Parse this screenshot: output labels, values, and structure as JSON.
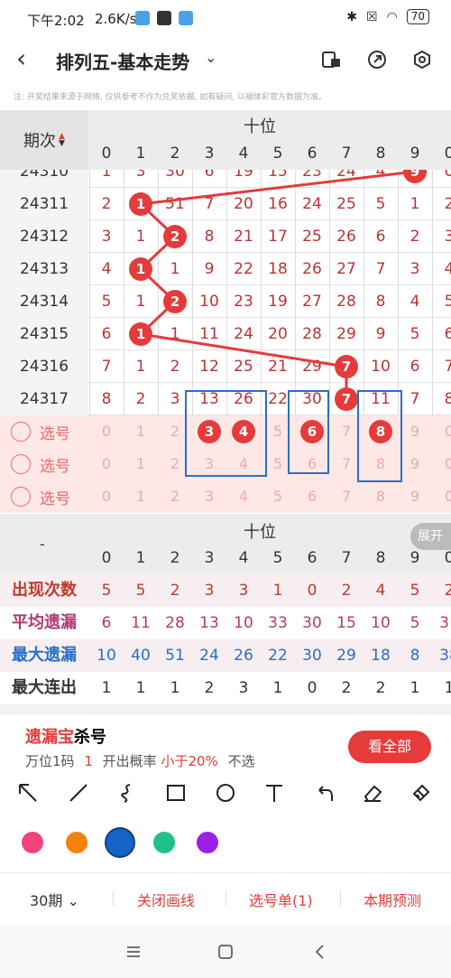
{
  "status": {
    "time": "下午2:02",
    "speed": "2.6K/s",
    "battery": "70"
  },
  "appbar": {
    "title": "排列五-基本走势"
  },
  "notice": "注: 开奖结果来源于网络, 仅供参考不作为兑奖依据, 如有疑问, 以福体彩官方数据为准。",
  "grid": {
    "period_header": "期次",
    "position_label": "十位",
    "columns": [
      "0",
      "1",
      "2",
      "3",
      "4",
      "5",
      "6",
      "7",
      "8",
      "9",
      "0"
    ],
    "rows": [
      {
        "period": "24310",
        "values": [
          "1",
          "3",
          "30",
          "6",
          "19",
          "15",
          "23",
          "24",
          "4",
          "9",
          "0"
        ],
        "hit": 9
      },
      {
        "period": "24311",
        "values": [
          "2",
          "1",
          "51",
          "7",
          "20",
          "16",
          "24",
          "25",
          "5",
          "1",
          "2"
        ],
        "hit": 1
      },
      {
        "period": "24312",
        "values": [
          "3",
          "1",
          "2",
          "8",
          "21",
          "17",
          "25",
          "26",
          "6",
          "2",
          "3"
        ],
        "hit": 2
      },
      {
        "period": "24313",
        "values": [
          "4",
          "1",
          "1",
          "9",
          "22",
          "18",
          "26",
          "27",
          "7",
          "3",
          "4"
        ],
        "hit": 1
      },
      {
        "period": "24314",
        "values": [
          "5",
          "1",
          "2",
          "10",
          "23",
          "19",
          "27",
          "28",
          "8",
          "4",
          "5"
        ],
        "hit": 2
      },
      {
        "period": "24315",
        "values": [
          "6",
          "1",
          "1",
          "11",
          "24",
          "20",
          "28",
          "29",
          "9",
          "5",
          "6"
        ],
        "hit": 1
      },
      {
        "period": "24316",
        "values": [
          "7",
          "1",
          "2",
          "12",
          "25",
          "21",
          "29",
          "7",
          "10",
          "6",
          "7"
        ],
        "hit": 7
      },
      {
        "period": "24317",
        "values": [
          "8",
          "2",
          "3",
          "13",
          "26",
          "22",
          "30",
          "7",
          "11",
          "7",
          "8"
        ],
        "hit": 7
      }
    ],
    "select_label": "选号",
    "select_rows": [
      {
        "nums": [
          "0",
          "1",
          "2",
          "3",
          "4",
          "5",
          "6",
          "7",
          "8",
          "9",
          "0"
        ],
        "balls": [
          3,
          4,
          6,
          8
        ]
      },
      {
        "nums": [
          "0",
          "1",
          "2",
          "3",
          "4",
          "5",
          "6",
          "7",
          "8",
          "9",
          "0"
        ],
        "balls": []
      },
      {
        "nums": [
          "0",
          "1",
          "2",
          "3",
          "4",
          "5",
          "6",
          "7",
          "8",
          "9",
          "0"
        ],
        "balls": []
      }
    ]
  },
  "stats": {
    "dash": "-",
    "position_label": "十位",
    "expand": "展开",
    "columns": [
      "0",
      "1",
      "2",
      "3",
      "4",
      "5",
      "6",
      "7",
      "8",
      "9",
      "0"
    ],
    "rows": [
      {
        "label": "出现次数",
        "color": "#c0392b",
        "values": [
          "5",
          "5",
          "2",
          "3",
          "3",
          "1",
          "0",
          "2",
          "4",
          "5",
          "2"
        ]
      },
      {
        "label": "平均遗漏",
        "color": "#b03a6e",
        "values": [
          "6",
          "11",
          "28",
          "13",
          "10",
          "33",
          "30",
          "15",
          "10",
          "5",
          "31"
        ]
      },
      {
        "label": "最大遗漏",
        "color": "#2a6ec8",
        "values": [
          "10",
          "40",
          "51",
          "24",
          "26",
          "22",
          "30",
          "29",
          "18",
          "8",
          "38"
        ]
      },
      {
        "label": "最大连出",
        "color": "#333333",
        "values": [
          "1",
          "1",
          "1",
          "2",
          "3",
          "1",
          "0",
          "2",
          "2",
          "1",
          "1"
        ]
      }
    ]
  },
  "promo": {
    "title_red": "遗漏宝",
    "title_black": "杀号",
    "sub1": "万位1码",
    "sub2": "1",
    "sub3": "开出概率",
    "sub4": "小于20%",
    "sub5": "不选",
    "view_all": "看全部"
  },
  "colors": [
    "#f0457a",
    "#f5820d",
    "#1663c7",
    "#1fc18a",
    "#9b1fe8"
  ],
  "bottombar": {
    "period": "30期",
    "close_lines": "关闭画线",
    "selection": "选号单(1)",
    "forecast": "本期预测"
  }
}
